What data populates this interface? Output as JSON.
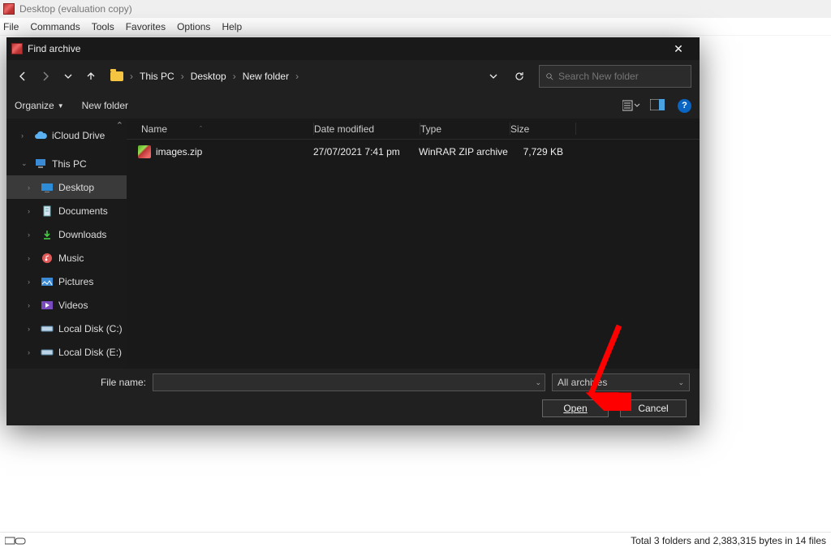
{
  "parentWindow": {
    "title": "Desktop (evaluation copy)",
    "menu": [
      "File",
      "Commands",
      "Tools",
      "Favorites",
      "Options",
      "Help"
    ]
  },
  "statusbar": {
    "right": "Total 3 folders and 2,383,315 bytes in 14 files"
  },
  "dialog": {
    "title": "Find archive",
    "breadcrumbs": [
      "This PC",
      "Desktop",
      "New folder"
    ],
    "searchPlaceholder": "Search New folder",
    "toolbar": {
      "organize": "Organize",
      "newFolder": "New folder"
    },
    "tree": [
      {
        "label": "iCloud Drive",
        "icon": "cloud",
        "expand": "right"
      },
      {
        "label": "This PC",
        "icon": "pc",
        "expand": "down"
      },
      {
        "label": "Desktop",
        "icon": "desktop",
        "sub": true,
        "selected": true
      },
      {
        "label": "Documents",
        "icon": "doc",
        "sub": true
      },
      {
        "label": "Downloads",
        "icon": "dl",
        "sub": true
      },
      {
        "label": "Music",
        "icon": "music",
        "sub": true
      },
      {
        "label": "Pictures",
        "icon": "pic",
        "sub": true
      },
      {
        "label": "Videos",
        "icon": "vid",
        "sub": true
      },
      {
        "label": "Local Disk (C:)",
        "icon": "disk",
        "sub": true
      },
      {
        "label": "Local Disk (E:)",
        "icon": "disk",
        "sub": true
      }
    ],
    "columns": {
      "name": "Name",
      "date": "Date modified",
      "type": "Type",
      "size": "Size"
    },
    "rows": [
      {
        "name": "images.zip",
        "date": "27/07/2021 7:41 pm",
        "type": "WinRAR ZIP archive",
        "size": "7,729 KB"
      }
    ],
    "fileNameLabel": "File name:",
    "fileTypeLabel": "All archives",
    "openLabel": "Open",
    "cancelLabel": "Cancel"
  }
}
